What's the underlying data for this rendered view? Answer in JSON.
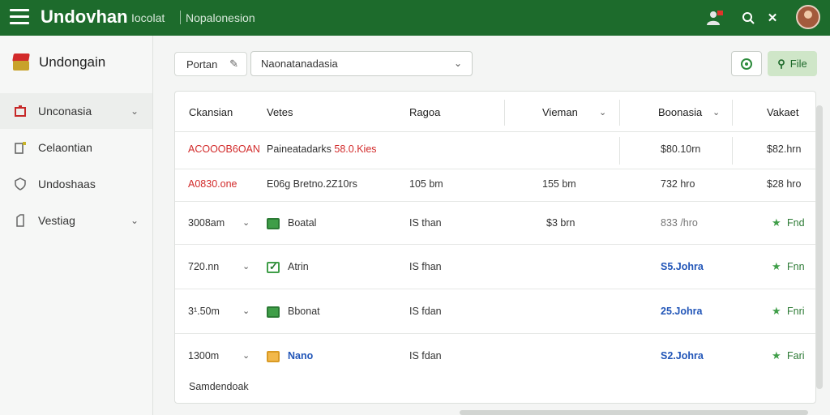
{
  "topbar": {
    "title": "Undovhan",
    "links": [
      "Iocolat",
      "Nopalonesion"
    ],
    "icons": [
      "user-alert-icon",
      "search-icon",
      "close-icon"
    ],
    "brand_color": "#1d6b2c"
  },
  "sidebar": {
    "brand": "Undongain",
    "items": [
      {
        "label": "Unconasia",
        "icon": "home-icon",
        "has_chevron": true,
        "active": true
      },
      {
        "label": "Celaontian",
        "icon": "folder-icon",
        "has_chevron": false,
        "active": false
      },
      {
        "label": "Undoshaas",
        "icon": "shield-icon",
        "has_chevron": false,
        "active": false
      },
      {
        "label": "Vestiag",
        "icon": "document-icon",
        "has_chevron": true,
        "active": false
      }
    ]
  },
  "toolbar": {
    "chip_label": "Portan",
    "select_value": "Naonatanadasia",
    "file_label": "File"
  },
  "table": {
    "headers": [
      "Ckansian",
      "Vetes",
      "Ragoa",
      "Vieman",
      "Boonasia",
      "Vakaet"
    ],
    "summary_rows": [
      {
        "c1": "ACOOOB6OAN",
        "c2": "Paineatadarks",
        "c2_highlight": "58.0.Kies",
        "c5": "$80.10rn",
        "c6": "$82.hrn"
      },
      {
        "c1": "A0830.one",
        "c2": "E06g Bretno.2Z10rs",
        "c3": "105 bm",
        "c4": "155 bm",
        "c5": "732 hro",
        "c6": "$28 hro"
      }
    ],
    "rows": [
      {
        "c1": "3008am",
        "name": "Boatal",
        "box": "green",
        "c3": "IS than",
        "c4": "$3 brn",
        "c5": "833 /hro",
        "c5_style": "muted",
        "c6": "Fnd"
      },
      {
        "c1": "720.nn",
        "name": "Atrin",
        "box": "check",
        "c3": "IS fhan",
        "c4": "",
        "c5": "S5.Johra",
        "c5_style": "blue",
        "c6": "Fnn"
      },
      {
        "c1": "3¹.50m",
        "name": "Bbonat",
        "box": "green",
        "c3": "IS fdan",
        "c4": "",
        "c5": "25.Johra",
        "c5_style": "blue",
        "c6": "Fnri"
      },
      {
        "c1": "1300m",
        "name": "Nano",
        "box": "yellow",
        "c3": "IS fdan",
        "c4": "",
        "c5": "S2.Johra",
        "c5_style": "blue",
        "c6": "Fari"
      }
    ],
    "footer": "Samdendoak"
  }
}
